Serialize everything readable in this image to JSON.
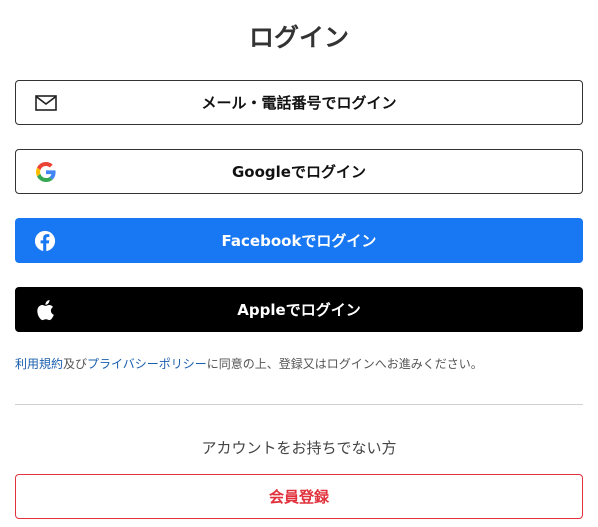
{
  "page": {
    "title": "ログイン"
  },
  "login_buttons": {
    "email": {
      "label": "メール・電話番号でログイン",
      "icon": "mail-icon"
    },
    "google": {
      "label": "Googleでログイン",
      "icon": "google-icon"
    },
    "facebook": {
      "label": "Facebookでログイン",
      "icon": "facebook-icon",
      "color": "#1877f2"
    },
    "apple": {
      "label": "Appleでログイン",
      "icon": "apple-icon",
      "color": "#000000"
    }
  },
  "terms": {
    "terms_link": "利用規約",
    "and": "及び",
    "privacy_link": "プライバシーポリシー",
    "rest": "に同意の上、登録又はログインへお進みください。",
    "link_color": "#1a5fae"
  },
  "register": {
    "prompt": "アカウントをお持ちでない方",
    "button_label": "会員登録",
    "accent_color": "#e0313c"
  }
}
